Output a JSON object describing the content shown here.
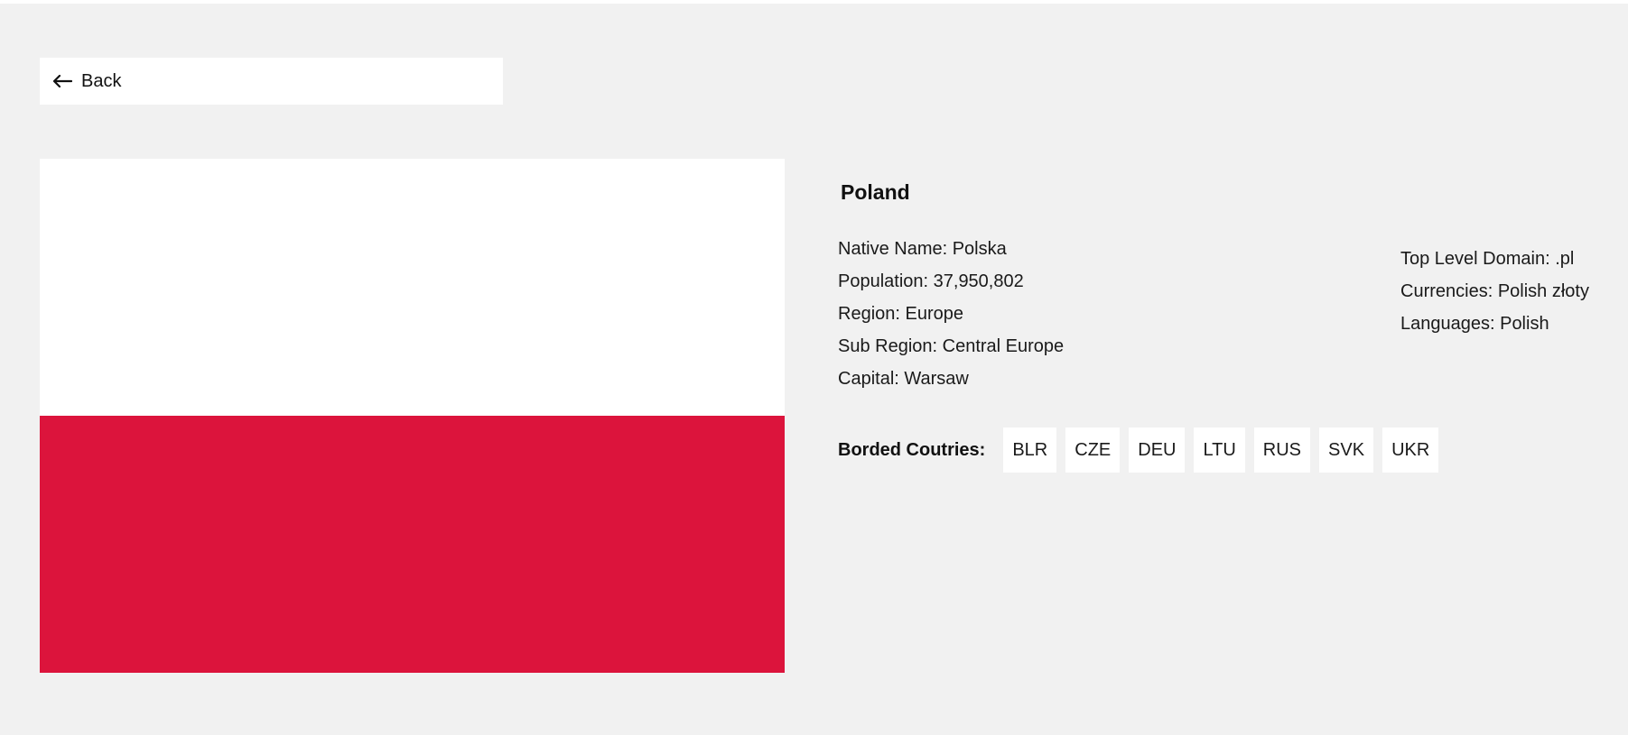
{
  "back_button": {
    "label": "Back",
    "icon": "arrow-left-icon"
  },
  "flag": {
    "colors": {
      "top": "#ffffff",
      "bottom": "#dc143c"
    }
  },
  "country": {
    "name": "Poland",
    "info_left": [
      "Native Name: Polska",
      "Population: 37,950,802",
      "Region: Europe",
      "Sub Region: Central Europe",
      "Capital: Warsaw"
    ],
    "info_right": [
      "Top Level Domain: .pl",
      "Currencies: Polish złoty",
      "Languages: Polish"
    ],
    "borders_label": "Borded Coutries:",
    "borders": [
      "BLR",
      "CZE",
      "DEU",
      "LTU",
      "RUS",
      "SVK",
      "UKR"
    ]
  },
  "colors": {
    "page_background": "#f1f1f1",
    "card_background": "#ffffff",
    "text": "#111111"
  }
}
